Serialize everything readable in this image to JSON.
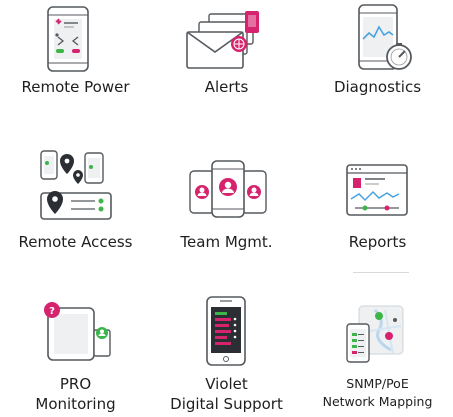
{
  "features": [
    {
      "label": "Remote Power",
      "icon": "remote-power-icon"
    },
    {
      "label": "Alerts",
      "icon": "alerts-icon"
    },
    {
      "label": "Diagnostics",
      "icon": "diagnostics-icon"
    },
    {
      "label": "Remote Access",
      "icon": "remote-access-icon"
    },
    {
      "label": "Team Mgmt.",
      "icon": "team-management-icon"
    },
    {
      "label": "Reports",
      "icon": "reports-icon"
    },
    {
      "label_line1": "PRO",
      "label_line2": "Monitoring",
      "icon": "pro-monitoring-icon"
    },
    {
      "label_line1": "Violet",
      "label_line2": "Digital Support",
      "icon": "violet-digital-support-icon"
    },
    {
      "label_line1": "SNMP/PoE",
      "label_line2": "Network Mapping",
      "icon": "snmp-poe-network-mapping-icon"
    }
  ],
  "colors": {
    "accent_magenta": "#d6236e",
    "accent_green": "#3cb54a",
    "stroke": "#555a5f",
    "fill_light": "#eef0f2",
    "blue": "#4aa3df",
    "dark": "#2b2f33"
  }
}
